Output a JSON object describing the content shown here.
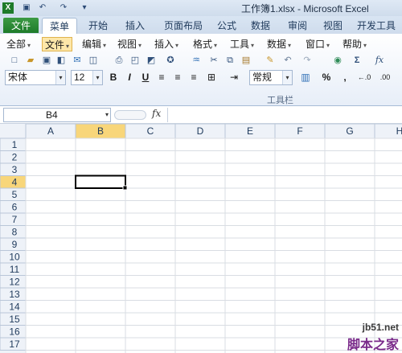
{
  "window": {
    "title": "工作簿1.xlsx - Microsoft Excel"
  },
  "ribbon_tabs": [
    {
      "label": "文件"
    },
    {
      "label": "菜单"
    },
    {
      "label": "开始"
    },
    {
      "label": "插入"
    },
    {
      "label": "页面布局"
    },
    {
      "label": "公式"
    },
    {
      "label": "数据"
    },
    {
      "label": "审阅"
    },
    {
      "label": "视图"
    },
    {
      "label": "开发工具"
    }
  ],
  "menu": [
    {
      "label": "全部"
    },
    {
      "label": "文件"
    },
    {
      "label": "编辑"
    },
    {
      "label": "视图"
    },
    {
      "label": "插入"
    },
    {
      "label": "格式"
    },
    {
      "label": "工具"
    },
    {
      "label": "数据"
    },
    {
      "label": "窗口"
    },
    {
      "label": "帮助"
    }
  ],
  "format": {
    "font": "宋体",
    "size": "12",
    "bold": "B",
    "italic": "I",
    "underline": "U",
    "number_format": "常规",
    "percent": "%",
    "comma": ","
  },
  "toolbar_group_label": "工具栏",
  "formula_bar": {
    "name_box": "B4",
    "fx": "fx",
    "formula": ""
  },
  "sheet": {
    "columns": [
      "A",
      "B",
      "C",
      "D",
      "E",
      "F",
      "G",
      "H"
    ],
    "rows": [
      "1",
      "2",
      "3",
      "4",
      "5",
      "6",
      "7",
      "8",
      "9",
      "10",
      "11",
      "12",
      "13",
      "14",
      "15",
      "16",
      "17"
    ],
    "active_cell": "B4"
  },
  "watermark": {
    "site": "jb51.net",
    "text": "脚本之家"
  }
}
